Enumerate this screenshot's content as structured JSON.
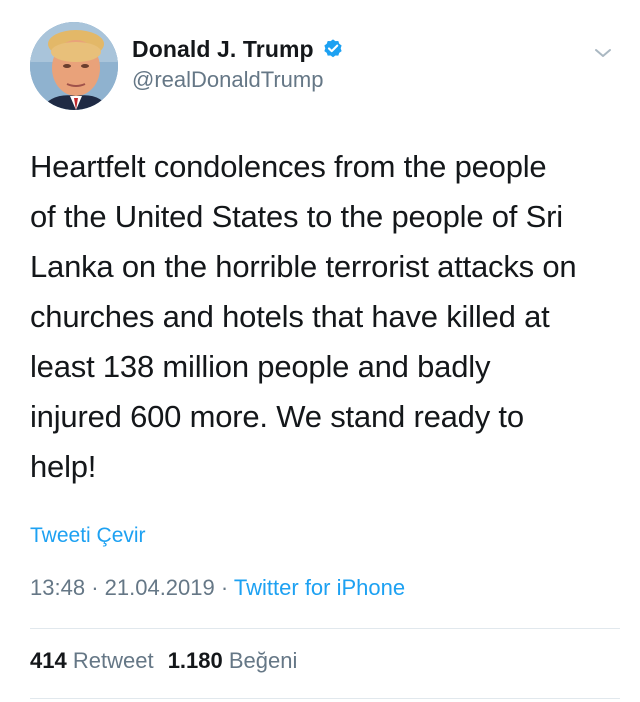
{
  "tweet": {
    "display_name": "Donald J. Trump",
    "handle": "@realDonaldTrump",
    "text": "Heartfelt condolences from the people\nof the United States to the people of Sri\nLanka on the horrible terrorist attacks on\nchurches and hotels that have killed at\nleast 138 million people and badly\ninjured 600 more. We stand ready to\nhelp!",
    "translate_label": "Tweeti Çevir",
    "time": "13:48",
    "date": "21.04.2019",
    "separator": "·",
    "source": "Twitter for iPhone",
    "retweet_count": "414",
    "retweet_label": "Retweet",
    "like_count": "1.180",
    "like_label": "Beğeni"
  },
  "icons": {
    "verified": "verified-badge-icon",
    "chevron": "chevron-down-icon"
  },
  "colors": {
    "link": "#1da1f2",
    "text": "#14171a",
    "secondary": "#657786",
    "divider": "#e1e8ed"
  }
}
